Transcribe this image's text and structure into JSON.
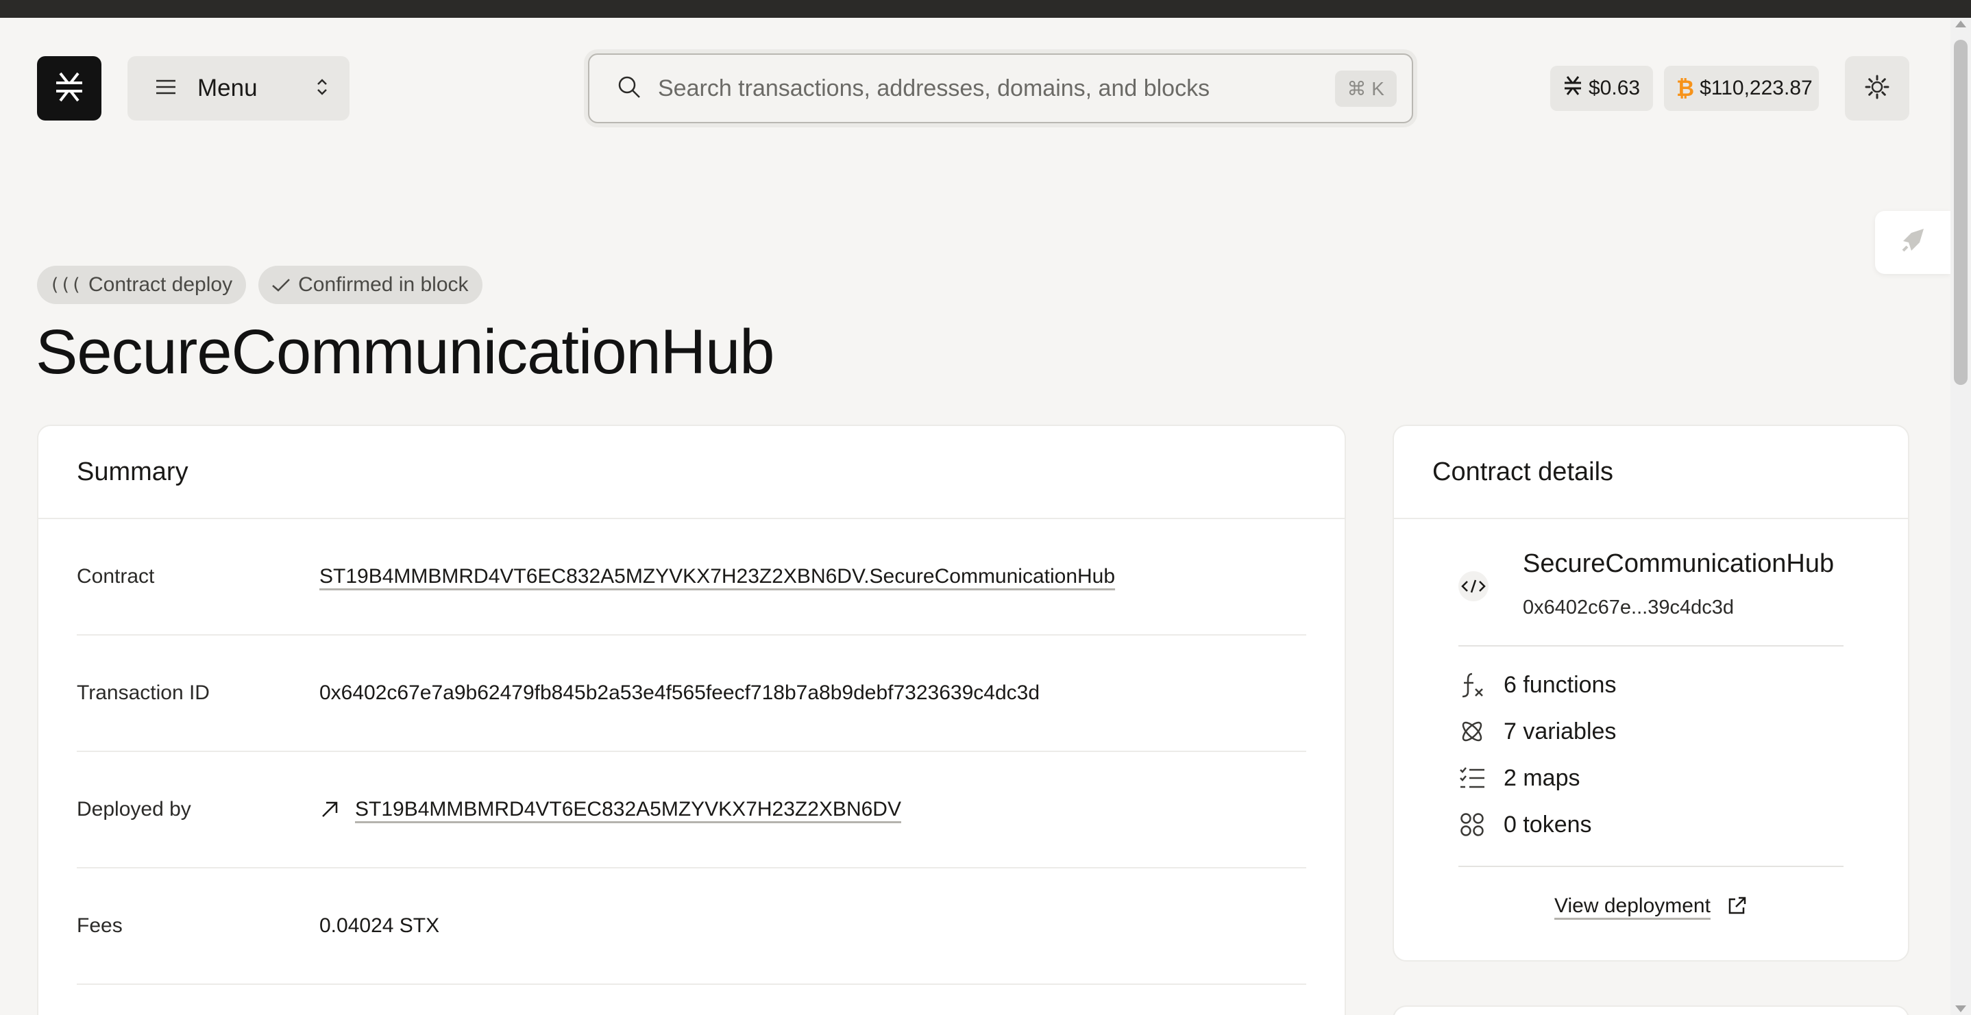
{
  "header": {
    "menu_label": "Menu",
    "search_placeholder": "Search transactions, addresses, domains, and blocks",
    "search_shortcut": "⌘  K",
    "stx_price": "$0.63",
    "btc_price": "$110,223.87"
  },
  "badges": {
    "type": "Contract deploy",
    "status": "Confirmed in block"
  },
  "page_title": "SecureCommunicationHub",
  "summary": {
    "title": "Summary",
    "rows": [
      {
        "label": "Contract",
        "value": "ST19B4MMBMRD4VT6EC832A5MZYVKX7H23Z2XBN6DV.SecureCommunicationHub"
      },
      {
        "label": "Transaction ID",
        "value": "0x6402c67e7a9b62479fb845b2a53e4f565feecf718b7a8b9debf7323639c4dc3d"
      },
      {
        "label": "Deployed by",
        "value": "ST19B4MMBMRD4VT6EC832A5MZYVKX7H23Z2XBN6DV"
      },
      {
        "label": "Fees",
        "value": "0.04024 STX"
      }
    ]
  },
  "contract_details": {
    "title": "Contract details",
    "name": "SecureCommunicationHub",
    "hash": "0x6402c67e...39c4dc3d",
    "stats": {
      "functions": "6 functions",
      "variables": "7 variables",
      "maps": "2 maps",
      "tokens": "0 tokens"
    },
    "view_deployment": "View deployment"
  },
  "colors": {
    "background": "#f6f5f3",
    "logo": "#121212",
    "btc_orange": "#f7931a",
    "card": "#ffffff"
  },
  "icons": [
    "stacks-logo-icon",
    "hamburger-icon",
    "chevron-updown-icon",
    "search-icon",
    "stx-icon",
    "bitcoin-icon",
    "gear-icon",
    "rocket-icon",
    "contract-icon",
    "check-icon",
    "arrow-up-right-icon",
    "code-icon",
    "function-icon",
    "variable-icon",
    "map-list-icon",
    "token-icon",
    "external-link-icon"
  ]
}
